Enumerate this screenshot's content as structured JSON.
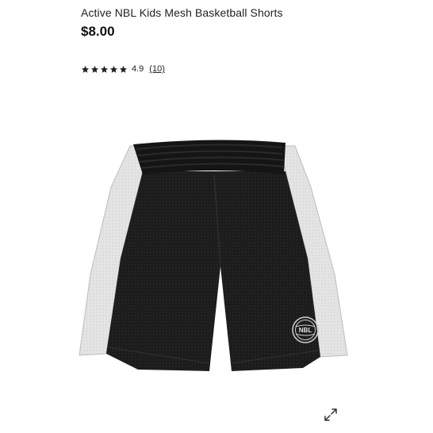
{
  "product": {
    "title": "Active NBL Kids Mesh Basketball Shorts",
    "price": "$8.00"
  },
  "rating": {
    "stars": 5,
    "value": "4.9",
    "review_count": "(10)",
    "star_color": "#222222"
  },
  "image": {
    "logo_text": "NBL",
    "icon": "shorts-image"
  },
  "controls": {
    "expand_icon": "expand-arrows-icon"
  }
}
